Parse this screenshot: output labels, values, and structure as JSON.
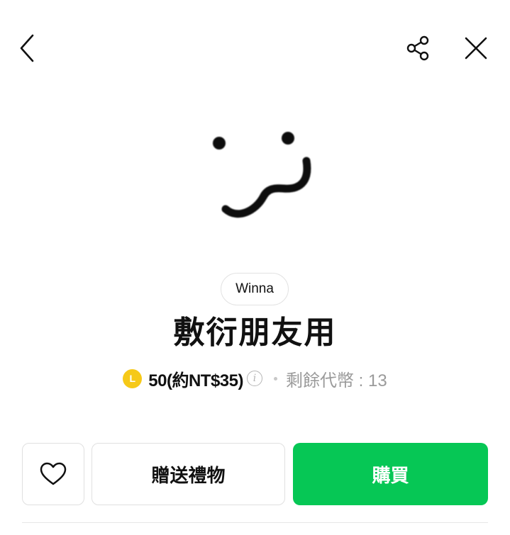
{
  "header": {
    "back_icon": "chevron-left-icon",
    "share_icon": "share-icon",
    "close_icon": "close-icon"
  },
  "sticker": {
    "icon": "smiley-face-sticker"
  },
  "product": {
    "author": "Winna",
    "title": "敷衍朋友用",
    "coin_letter": "L",
    "price": "50(約NT$35)",
    "info_icon": "info-icon",
    "remaining": "剩餘代幣 : 13"
  },
  "actions": {
    "favorite_icon": "heart-outline-icon",
    "gift_label": "贈送禮物",
    "buy_label": "購買"
  },
  "colors": {
    "accent_green": "#06c755",
    "coin_yellow": "#f6c918",
    "muted_text": "#9a9a9a"
  }
}
